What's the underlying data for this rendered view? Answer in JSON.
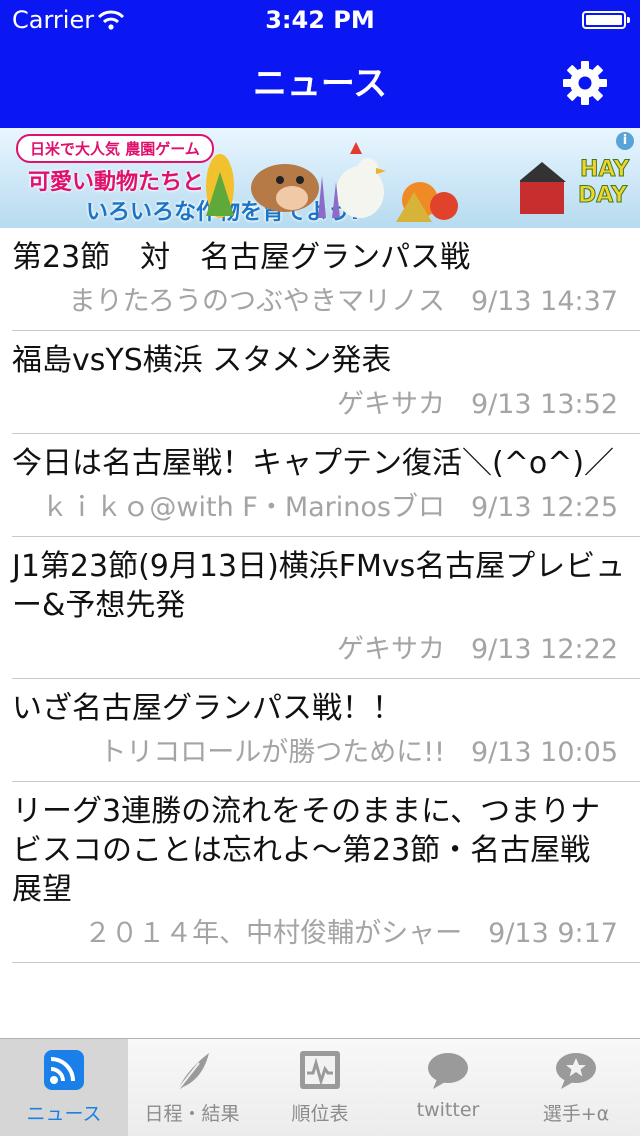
{
  "status_bar": {
    "carrier": "Carrier",
    "time": "3:42 PM"
  },
  "nav": {
    "title": "ニュース",
    "settings_icon": "gear-icon"
  },
  "ad": {
    "pill": "日米で大人気 農園ゲーム",
    "line1": "可愛い動物たちと",
    "line2": "いろいろな作物を育てよう!",
    "logo": "HAY DAY",
    "info": "i"
  },
  "news": [
    {
      "title": "第23節　対　名古屋グランパス戦",
      "source": "まりたろうのつぶやきマリノス",
      "date": "9/13 14:37"
    },
    {
      "title": "福島vsYS横浜 スタメン発表",
      "source": "ゲキサカ",
      "date": "9/13 13:52"
    },
    {
      "title": "今日は名古屋戦！キャプテン復活＼(^o^)／",
      "source": "ｋｉｋｏ@with F・Marinosブロ",
      "date": "9/13 12:25"
    },
    {
      "title": "J1第23節(9月13日)横浜FMvs名古屋プレビュー&予想先発",
      "source": "ゲキサカ",
      "date": "9/13 12:22"
    },
    {
      "title": "いざ名古屋グランパス戦！！",
      "source": "トリコロールが勝つために!!",
      "date": "9/13 10:05"
    },
    {
      "title": "リーグ3連勝の流れをそのままに、つまりナビスコのことは忘れよ～第23節・名古屋戦 展望",
      "source": "２０１４年、中村俊輔がシャー",
      "date": "9/13 9:17"
    }
  ],
  "tabs": [
    {
      "label": "ニュース",
      "icon": "rss-icon",
      "active": true
    },
    {
      "label": "日程・結果",
      "icon": "feather-icon",
      "active": false
    },
    {
      "label": "順位表",
      "icon": "chart-icon",
      "active": false
    },
    {
      "label": "twitter",
      "icon": "speech-bubble-icon",
      "active": false
    },
    {
      "label": "選手+α",
      "icon": "star-bubble-icon",
      "active": false
    }
  ],
  "colors": {
    "header": "#0a17f2",
    "accent": "#1a7fe8",
    "meta_text": "#a4a4a4"
  }
}
